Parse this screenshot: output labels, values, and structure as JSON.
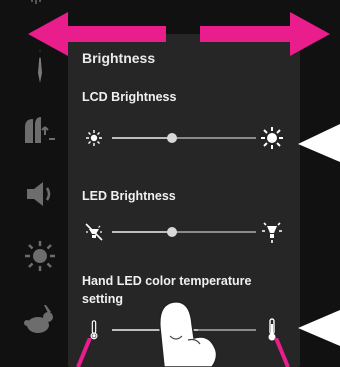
{
  "panel": {
    "title": "Brightness",
    "lcd": {
      "label": "LCD Brightness",
      "value_fraction": 0.42,
      "lead_icon": "sun-small-icon",
      "trail_icon": "sun-large-icon"
    },
    "led": {
      "label": "LED Brightness",
      "value_fraction": 0.42,
      "lead_icon": "led-off-icon",
      "trail_icon": "led-on-icon"
    },
    "temp": {
      "label_line1": "Hand LED color temperature",
      "label_line2": "setting",
      "lead_icon": "thermometer-low-icon",
      "trail_icon": "thermometer-high-icon"
    }
  },
  "sidebar_icons": [
    "needle-icon",
    "thread-tension-icon",
    "speaker-icon",
    "brightness-icon",
    "rabbit-icon"
  ],
  "overlay_icons": [
    "swipe-arrow-icon",
    "hand-pointer-icon",
    "callout-pointer-icon"
  ],
  "colors": {
    "accent_pink": "#e91e8c",
    "panel": "#262626",
    "background": "#111111"
  }
}
